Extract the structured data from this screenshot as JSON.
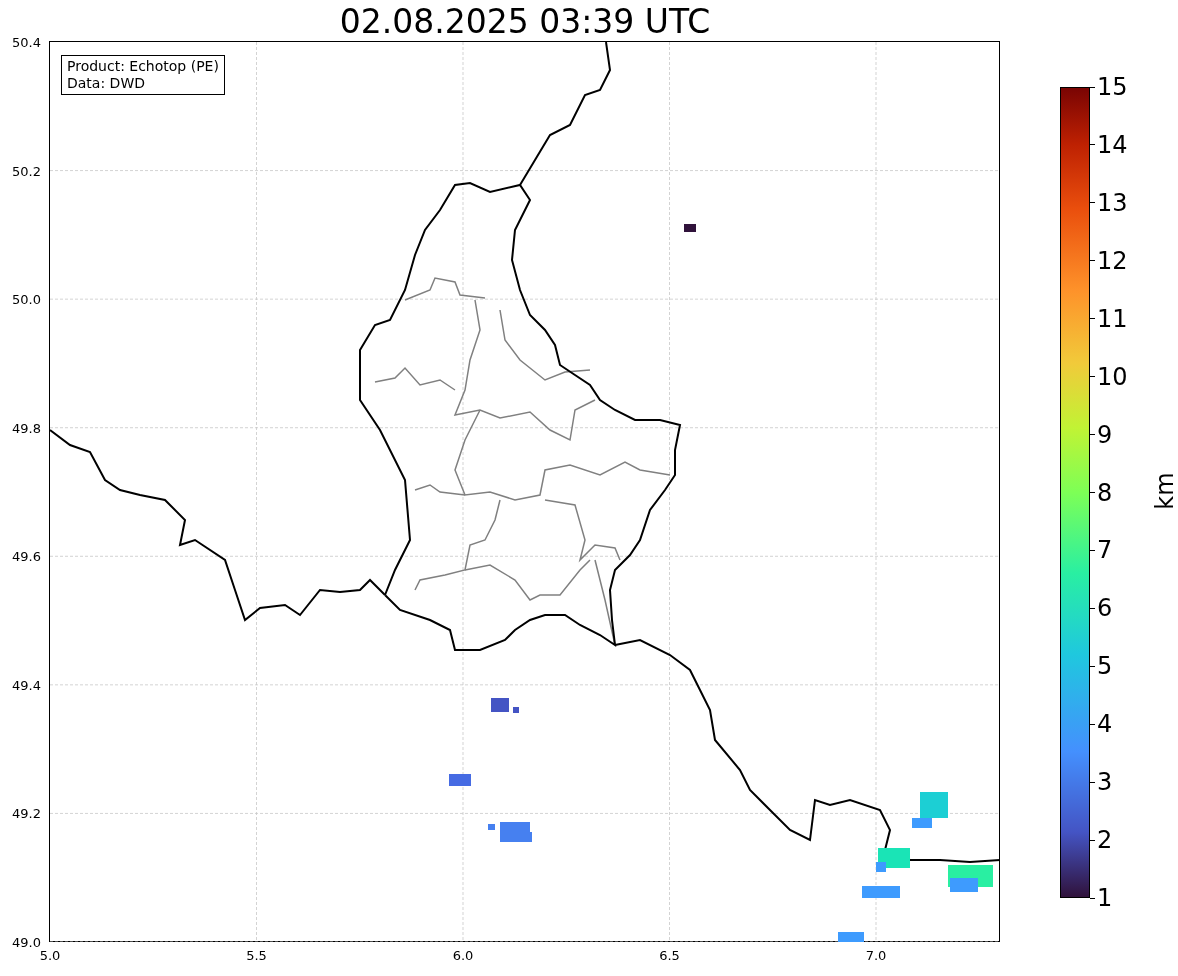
{
  "title": "02.08.2025 03:39 UTC",
  "info_box": [
    "Product: Echotop (PE)",
    "Data: DWD"
  ],
  "x_axis": {
    "ticks": [
      "5.0",
      "5.5",
      "6.0",
      "6.5",
      "7.0"
    ]
  },
  "y_axis": {
    "ticks": [
      "50.4",
      "50.2",
      "50.0",
      "49.8",
      "49.6",
      "49.4",
      "49.2",
      "49.0"
    ]
  },
  "colorbar": {
    "label": "km",
    "ticks": [
      "15",
      "14",
      "13",
      "12",
      "11",
      "10",
      "9",
      "8",
      "7",
      "6",
      "5",
      "4",
      "3",
      "2",
      "1"
    ]
  }
}
